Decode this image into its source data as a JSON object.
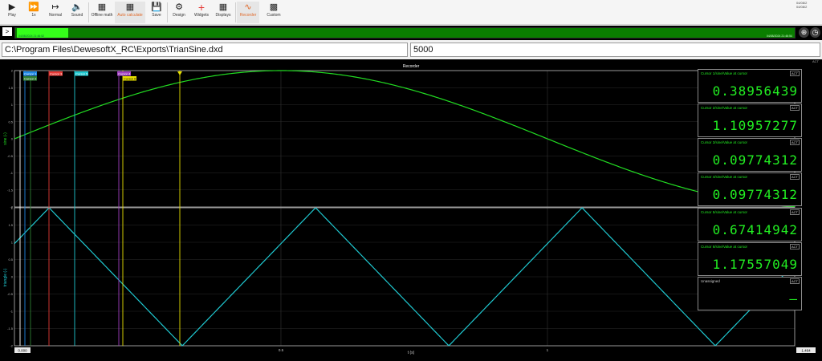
{
  "toolbar": {
    "play": {
      "icon": "play-icon",
      "label": "Play"
    },
    "speed": {
      "icon": "fast-forward-icon",
      "label": "1x"
    },
    "normal": {
      "icon": "normal-icon",
      "label": "Normal"
    },
    "sound": {
      "icon": "sound-mute-icon",
      "label": "Sound"
    },
    "offline_math": {
      "icon": "calculator-icon",
      "label": "Offline math"
    },
    "auto_calculate": {
      "icon": "calculator-auto-icon",
      "label": "Auto calculate"
    },
    "save": {
      "icon": "save-icon",
      "label": "Save"
    },
    "design": {
      "icon": "gear-icon",
      "label": "Design"
    },
    "widgets": {
      "icon": "plus-icon",
      "label": "Widgets"
    },
    "displays": {
      "icon": "displays-icon",
      "label": "Displays"
    },
    "recorder": {
      "icon": "recorder-icon",
      "label": "Recorder"
    },
    "custom": {
      "icon": "terminal-icon",
      "label": "Custom"
    },
    "right_date_1": "04/08/2",
    "right_date_2": "04/08/2"
  },
  "timeline": {
    "expand_glyph": ">",
    "start_time": "04/08/2024 21:46:52",
    "end_time": "04/08/2024 21:46:54"
  },
  "file_path": "C:\\Program Files\\DewesoftX_RC\\Exports\\TrianSine.dxd",
  "value_field": "5000",
  "recorder": {
    "title": "Recorder",
    "badge": "ACT",
    "sine_ylabel": "sine (-)",
    "tri_ylabel": "triangle (-)",
    "xlabel": "t (s)",
    "x_start_label": "0.000",
    "x_end_label": "1.464",
    "colors": {
      "sine": "#22dd22",
      "triangle": "#1fc8d0"
    }
  },
  "cursor_tags": [
    {
      "label": "Cursor 1",
      "color": "#1e88e5"
    },
    {
      "label": "Cursor 2",
      "color": "#2e7d32"
    },
    {
      "label": "Cursor 3",
      "color": "#e53935"
    },
    {
      "label": "Cursor 5",
      "color": "#1fc8d0"
    },
    {
      "label": "Cursor 4",
      "color": "#a040c0"
    },
    {
      "label": "Cursor 6",
      "color": "#e8e000"
    }
  ],
  "cursor_panels": [
    {
      "label": "Cursor 1/sine/Value at cursor",
      "value": "0.38956439",
      "badge": "ACT"
    },
    {
      "label": "Cursor 2/sine/Value at cursor",
      "value": "1.10957277",
      "badge": "ACT"
    },
    {
      "label": "Cursor 3/sine/Value at cursor",
      "value": "0.09774312",
      "badge": "ACT"
    },
    {
      "label": "Cursor 4/sine/Value at cursor",
      "value": "0.09774312",
      "badge": "ACT"
    },
    {
      "label": "Cursor 5/sine/Value at cursor",
      "value": "0.67414942",
      "badge": "ACT"
    },
    {
      "label": "Cursor 6/sine/Value at cursor",
      "value": "1.17557049",
      "badge": "ACT"
    },
    {
      "label": "Unassigned",
      "value": "—",
      "badge": "ACT"
    }
  ],
  "chart_data": [
    {
      "type": "line",
      "ylabel": "sine (-)",
      "xlabel": "t (s)",
      "xlim": [
        0,
        1.464
      ],
      "ylim": [
        -2,
        2
      ],
      "y_ticks": [
        "2",
        "1.5",
        "1",
        "0.5",
        "0",
        "-0.5",
        "-1",
        "-1.5",
        "-2"
      ],
      "x_ticks": [
        0.5,
        1
      ],
      "x_tick_labels": [
        "0.5",
        "1"
      ],
      "series": [
        {
          "function": "sine",
          "amplitude": 2,
          "frequency_hz": 0.5,
          "color": "#22dd22"
        }
      ]
    },
    {
      "type": "line",
      "ylabel": "triangle (-)",
      "xlabel": "t (s)",
      "xlim": [
        0,
        1.464
      ],
      "ylim": [
        -2,
        2
      ],
      "y_ticks": [
        "2",
        "1.5",
        "1",
        "0.5",
        "0",
        "-0.5",
        "-1",
        "-1.5",
        "-2"
      ],
      "x_ticks": [
        0.5,
        1
      ],
      "x_tick_labels": [
        "0.5",
        "1"
      ],
      "series": [
        {
          "function": "triangle",
          "amplitude": 2,
          "period_s": 0.5,
          "peak_times": [
            0.065,
            0.315,
            0.565,
            0.815,
            1.065,
            1.315
          ],
          "color": "#1fc8d0"
        }
      ]
    }
  ]
}
